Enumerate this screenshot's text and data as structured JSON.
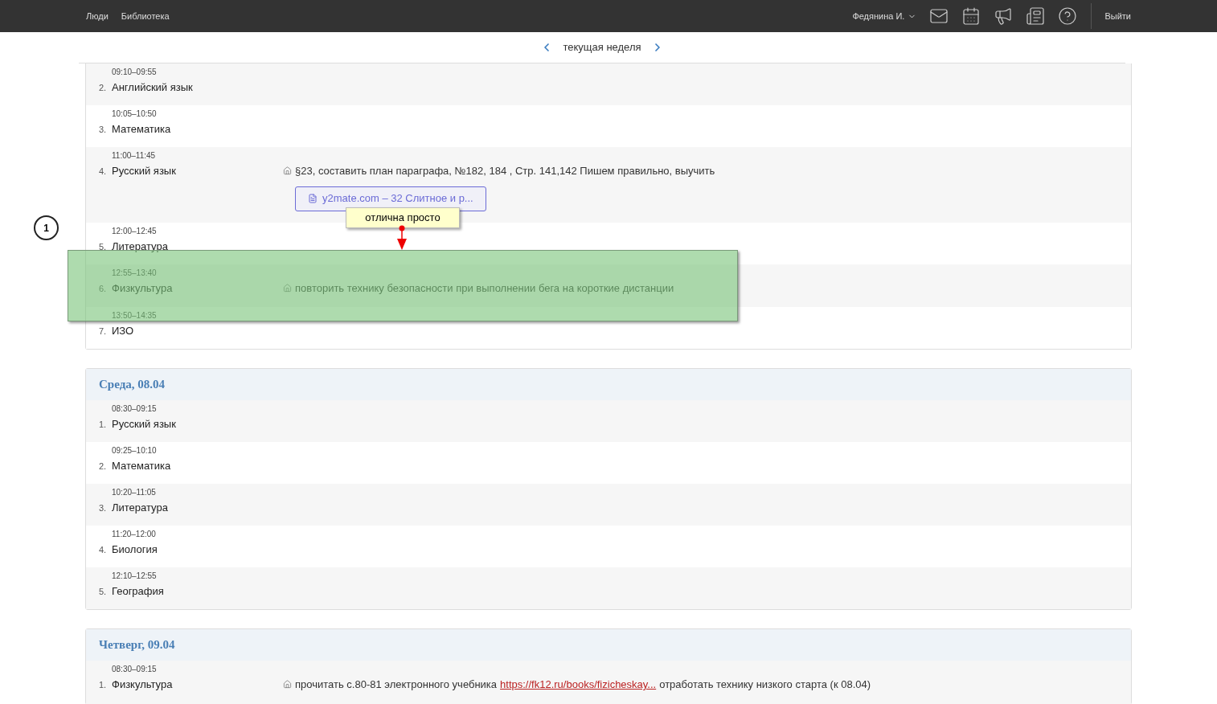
{
  "topbar": {
    "nav": [
      "Люди",
      "Библиотека"
    ],
    "user": "Федянина И.",
    "logout": "Выйти"
  },
  "week_nav": {
    "label": "текущая неделя"
  },
  "days": [
    {
      "lessons": [
        {
          "time": "09:10–09:55",
          "number": "2.",
          "subject": "Английский язык"
        },
        {
          "time": "10:05–10:50",
          "number": "3.",
          "subject": "Математика"
        },
        {
          "time": "11:00–11:45",
          "number": "4.",
          "subject": "Русский язык",
          "homework": [
            {
              "kind": "text",
              "text": "§23, составить план параграфа, №182, 184 , Стр. 141,142 Пишем правильно, выучить"
            }
          ],
          "attachment": "y2mate.com – 32 Слитное и р..."
        },
        {
          "time": "12:00–12:45",
          "number": "5.",
          "subject": "Литература"
        },
        {
          "time": "12:55–13:40",
          "number": "6.",
          "subject": "Физкультура",
          "homework": [
            {
              "kind": "text",
              "text": "повторить технику безопасности при выполнении бега на короткие дистанции"
            }
          ]
        },
        {
          "time": "13:50–14:35",
          "number": "7.",
          "subject": "ИЗО"
        }
      ]
    },
    {
      "title": "Среда, 08.04",
      "lessons": [
        {
          "time": "08:30–09:15",
          "number": "1.",
          "subject": "Русский язык"
        },
        {
          "time": "09:25–10:10",
          "number": "2.",
          "subject": "Математика"
        },
        {
          "time": "10:20–11:05",
          "number": "3.",
          "subject": "Литература"
        },
        {
          "time": "11:20–12:00",
          "number": "4.",
          "subject": "Биология"
        },
        {
          "time": "12:10–12:55",
          "number": "5.",
          "subject": "География"
        }
      ]
    },
    {
      "title": "Четверг, 09.04",
      "lessons": [
        {
          "time": "08:30–09:15",
          "number": "1.",
          "subject": "Физкультура",
          "homework": [
            {
              "kind": "text",
              "text": "прочитать с.80-81 электронного учебника"
            },
            {
              "kind": "link",
              "text": "https://fk12.ru/books/fizicheskay..."
            },
            {
              "kind": "text",
              "text": "отработать технику низкого старта (к 08.04)"
            }
          ]
        }
      ]
    }
  ],
  "annotations": {
    "marker": "1",
    "callout": "отлична просто"
  }
}
